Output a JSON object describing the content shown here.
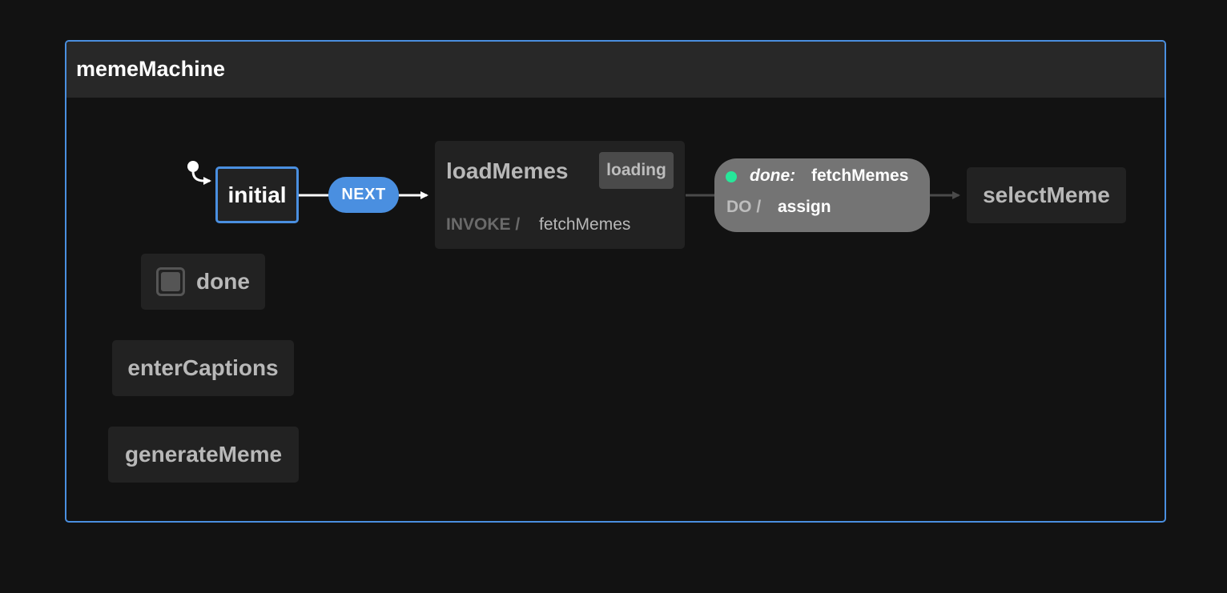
{
  "machine": {
    "title": "memeMachine"
  },
  "states": {
    "initial": "initial",
    "done": "done",
    "enterCaptions": "enterCaptions",
    "generateMeme": "generateMeme",
    "loadMemes": {
      "title": "loadMemes",
      "tag": "loading",
      "invoke_keyword": "INVOKE /",
      "invoke_value": "fetchMemes"
    },
    "selectMeme": "selectMeme"
  },
  "transitions": {
    "next_event": "NEXT",
    "done_event": {
      "keyword": "done:",
      "value": "fetchMemes",
      "action_keyword": "DO /",
      "action_value": "assign"
    }
  },
  "colors": {
    "active_border": "#4a8fe0",
    "event_pill": "#4a8fe0",
    "done_dot": "#27e79a",
    "background": "#121212"
  }
}
